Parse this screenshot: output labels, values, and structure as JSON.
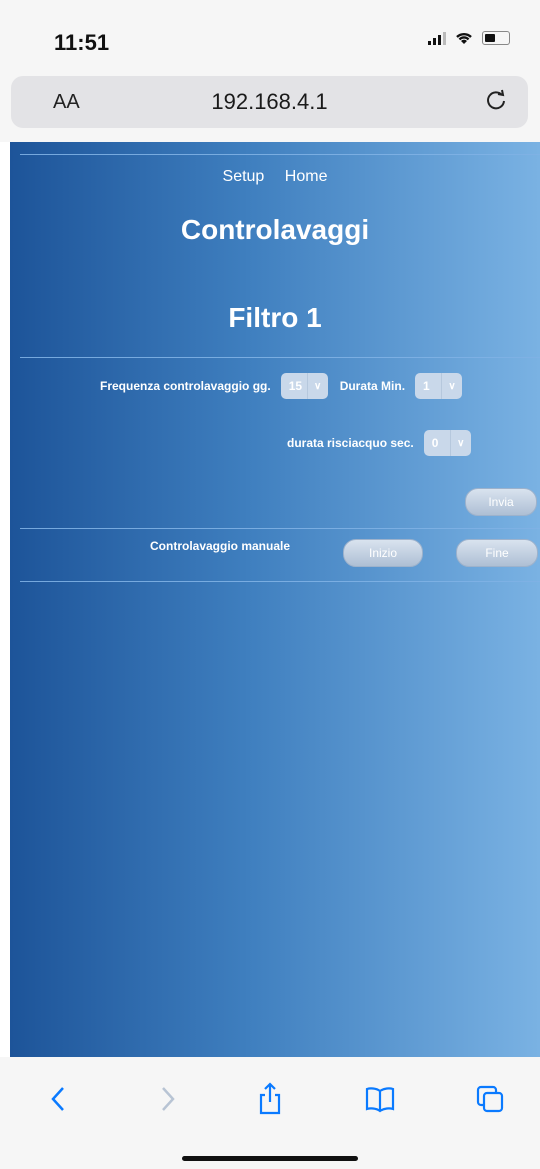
{
  "status_bar": {
    "time": "11:51"
  },
  "browser": {
    "text_size": "AA",
    "url": "192.168.4.1"
  },
  "nav": {
    "setup": "Setup",
    "home": "Home"
  },
  "page": {
    "title": "Controlavaggi",
    "subtitle": "Filtro 1",
    "frequency": {
      "label": "Frequenza controlavaggio gg.",
      "value": "15"
    },
    "duration": {
      "label": "Durata Min.",
      "value": "1"
    },
    "rinse": {
      "label": "durata risciacquo sec.",
      "value": "0"
    },
    "send_button": "Invia",
    "manual": {
      "label": "Controlavaggio manuale",
      "start": "Inizio",
      "end": "Fine"
    }
  },
  "colors": {
    "gradient_left": "#1d5499",
    "gradient_right": "#7ab2e3",
    "ios_blue": "#0a7aff"
  },
  "toolbar": {
    "icons": [
      "back-icon",
      "forward-icon",
      "share-icon",
      "bookmarks-icon",
      "tabs-icon"
    ]
  }
}
